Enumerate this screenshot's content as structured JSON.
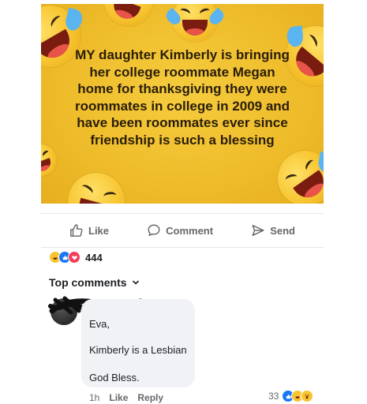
{
  "post": {
    "text_lines": [
      "MY daughter Kimberly is bringing",
      "her college roommate Megan",
      "home for thanksgiving they were",
      "roommates in college in 2009 and",
      "have been roommates ever since",
      "friendship is such a blessing"
    ]
  },
  "actions": {
    "like": "Like",
    "comment": "Comment",
    "send": "Send"
  },
  "reactions": {
    "icons": [
      "haha-reaction-icon",
      "like-reaction-icon",
      "love-reaction-icon"
    ],
    "count": "444"
  },
  "comments_section": {
    "title": "Top comments",
    "icon": "chevron-down-icon"
  },
  "comment": {
    "lines": [
      "Eva,",
      "Kimberly is a Lesbian",
      "God Bless."
    ],
    "time": "1h",
    "like": "Like",
    "reply": "Reply",
    "reaction_count": "33",
    "reaction_icons": [
      "like-reaction-icon",
      "haha-reaction-icon",
      "wow-reaction-icon"
    ]
  },
  "colors": {
    "image_bg": "#efbd2c",
    "muted_text": "#65676b",
    "like_blue": "#1877f2",
    "love_red": "#f33e58",
    "bubble_bg": "#f0f2f5"
  }
}
